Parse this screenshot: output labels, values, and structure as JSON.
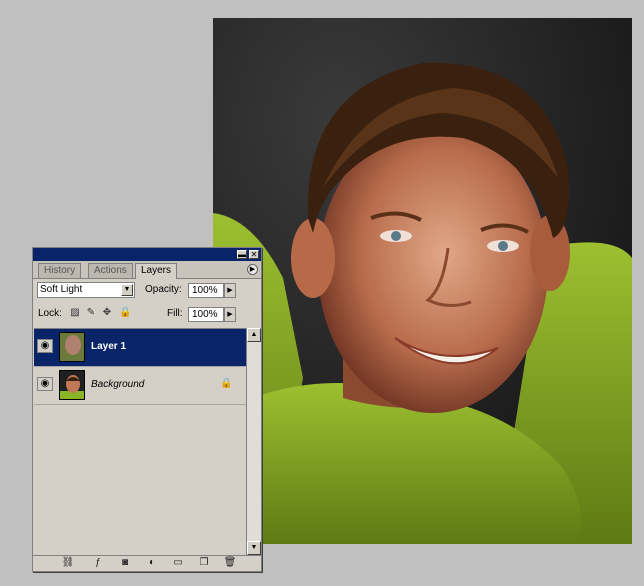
{
  "palette": {
    "tabs": [
      "History",
      "Actions",
      "Layers"
    ],
    "active_tab": "Layers",
    "blend_mode": "Soft Light",
    "opacity_label": "Opacity:",
    "opacity_value": "100%",
    "lock_label": "Lock:",
    "fill_label": "Fill:",
    "fill_value": "100%",
    "layers": [
      {
        "name": "Layer 1",
        "selected": true,
        "visible": true
      },
      {
        "name": "Background",
        "selected": false,
        "visible": true,
        "locked": true
      }
    ]
  },
  "icons": {
    "visibility": "eye-icon",
    "lock_transparent": "lock-transparency-icon",
    "lock_image": "brush-icon",
    "lock_position": "move-icon",
    "lock_all": "padlock-icon",
    "bottom": [
      "link-layers-icon",
      "layer-style-icon",
      "layer-mask-icon",
      "adjustment-layer-icon",
      "new-group-icon",
      "new-layer-icon",
      "trash-icon"
    ]
  },
  "colors": {
    "selection": "#0a246a",
    "panel": "#d4d0c8",
    "background": "#c0c0c0"
  }
}
